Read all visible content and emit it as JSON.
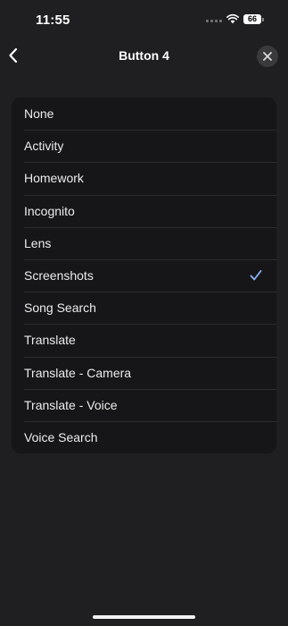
{
  "status_bar": {
    "time": "11:55",
    "battery": "66",
    "wifi_icon": "wifi-icon",
    "signal_icon": "signal-dots-icon"
  },
  "header": {
    "title": "Button 4",
    "back_icon": "chevron-left-icon",
    "close_icon": "close-icon"
  },
  "options": [
    {
      "label": "None",
      "selected": false
    },
    {
      "label": "Activity",
      "selected": false
    },
    {
      "label": "Homework",
      "selected": false
    },
    {
      "label": "Incognito",
      "selected": false
    },
    {
      "label": "Lens",
      "selected": false
    },
    {
      "label": "Screenshots",
      "selected": true
    },
    {
      "label": "Song Search",
      "selected": false
    },
    {
      "label": "Translate",
      "selected": false
    },
    {
      "label": "Translate - Camera",
      "selected": false
    },
    {
      "label": "Translate - Voice",
      "selected": false
    },
    {
      "label": "Voice Search",
      "selected": false
    }
  ],
  "colors": {
    "background": "#1f1f21",
    "card": "#161618",
    "accent": "#8ab4f8"
  }
}
